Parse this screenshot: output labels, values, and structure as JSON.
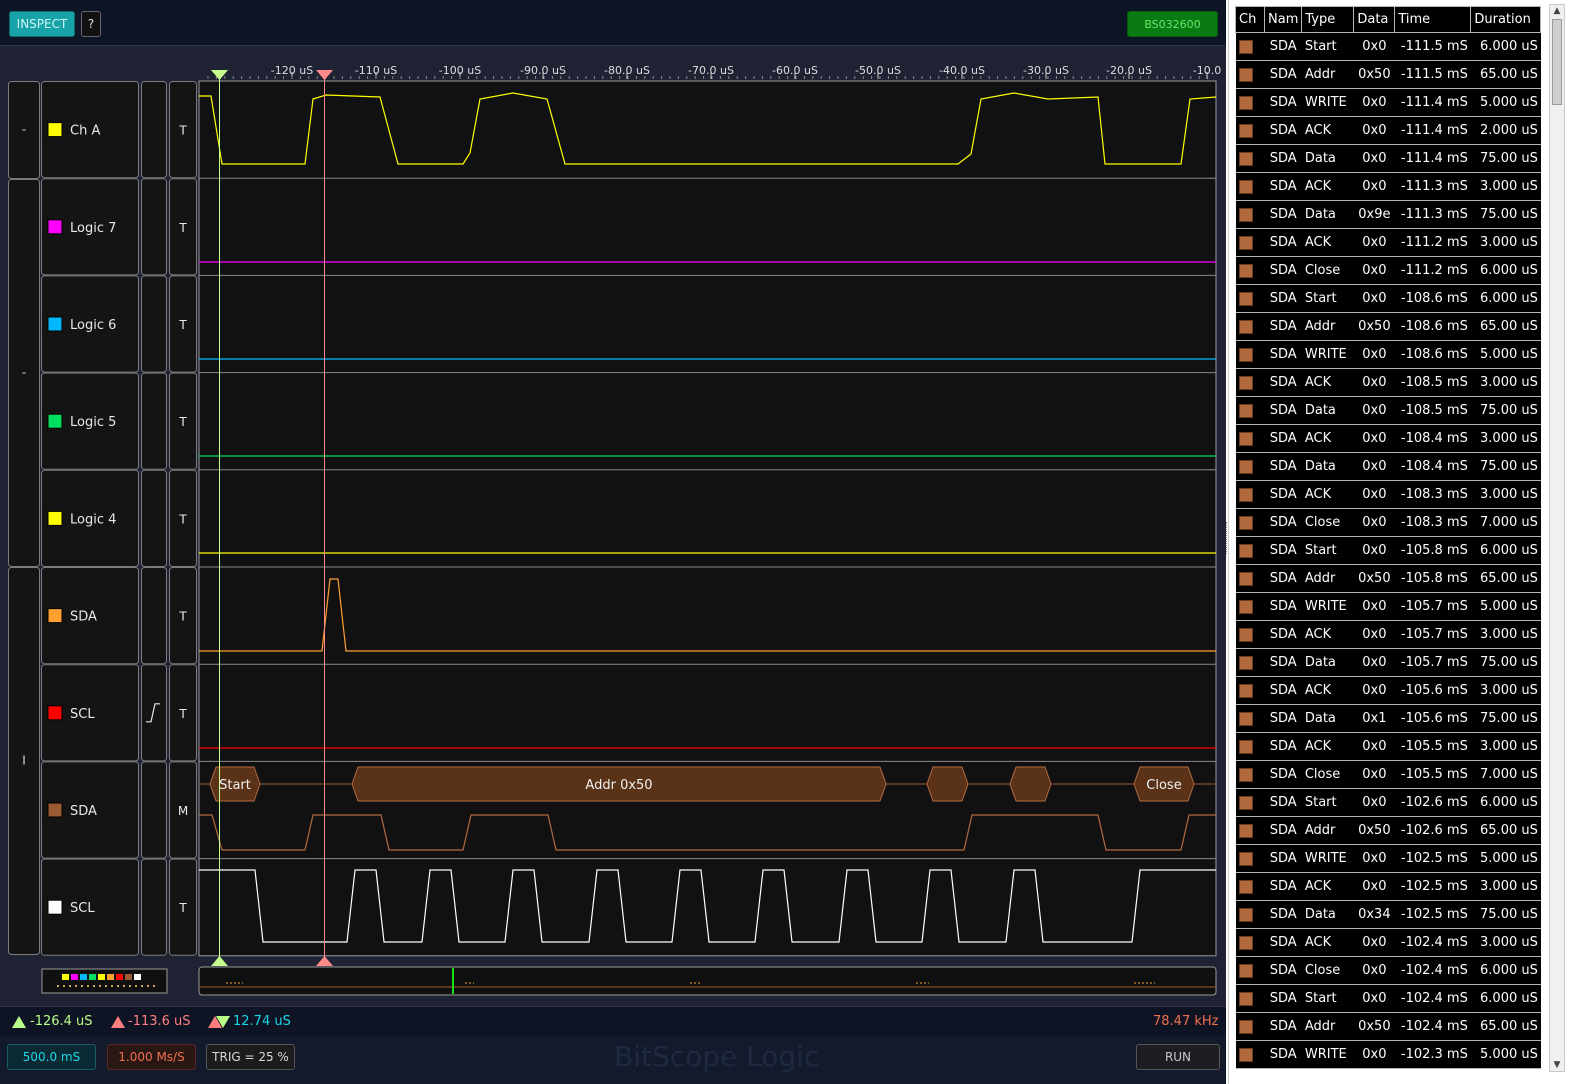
{
  "toolbar": {
    "inspect_label": "INSPECT",
    "help_label": "?",
    "device_label": "BS032600"
  },
  "timeline": {
    "tick_labels": [
      "-120 uS",
      "-110 uS",
      "-100 uS",
      "-90.0 uS",
      "-80.0 uS",
      "-70.0 uS",
      "-60.0 uS",
      "-50.0 uS",
      "-40.0 uS",
      "-30.0 uS",
      "-20.0 uS",
      "-10.0"
    ]
  },
  "groups": [
    "-",
    "-",
    "I"
  ],
  "channels": [
    {
      "name": "Ch A",
      "color": "#ffff00",
      "mode": "T",
      "trigger": ""
    },
    {
      "name": "Logic 7",
      "color": "#ff00ff",
      "mode": "T",
      "trigger": ""
    },
    {
      "name": "Logic 6",
      "color": "#00b8ff",
      "mode": "T",
      "trigger": ""
    },
    {
      "name": "Logic 5",
      "color": "#00e060",
      "mode": "T",
      "trigger": ""
    },
    {
      "name": "Logic 4",
      "color": "#ffff00",
      "mode": "T",
      "trigger": ""
    },
    {
      "name": "SDA",
      "color": "#ffa030",
      "mode": "T",
      "trigger": ""
    },
    {
      "name": "SCL",
      "color": "#ff0000",
      "mode": "T",
      "trigger": "rising-edge"
    },
    {
      "name": "SDA",
      "color": "#9c5a34",
      "mode": "M",
      "trigger": ""
    },
    {
      "name": "SCL",
      "color": "#ffffff",
      "mode": "T",
      "trigger": ""
    }
  ],
  "decode_labels": {
    "start": "Start",
    "addr": "Addr 0x50",
    "close": "Close"
  },
  "cursors": {
    "a_value": "-126.4 uS",
    "b_value": "-113.6 uS",
    "delta_value": "12.74 uS",
    "frequency": "78.47 kHz"
  },
  "bottombar": {
    "timebase": "500.0 mS",
    "sample_rate": "1.000 Ms/S",
    "trigger": "TRIG = 25 %",
    "run_label": "RUN",
    "watermark": "BitScope Logic"
  },
  "table": {
    "headers": [
      "Ch",
      "Nam",
      "Type",
      "Data",
      "Time",
      "Duration"
    ],
    "rows": [
      [
        "SDA",
        "Start",
        "0x0",
        "-111.5 mS",
        "6.000 uS"
      ],
      [
        "SDA",
        "Addr",
        "0x50",
        "-111.5 mS",
        "65.00 uS"
      ],
      [
        "SDA",
        "WRITE",
        "0x0",
        "-111.4 mS",
        "5.000 uS"
      ],
      [
        "SDA",
        "ACK",
        "0x0",
        "-111.4 mS",
        "2.000 uS"
      ],
      [
        "SDA",
        "Data",
        "0x0",
        "-111.4 mS",
        "75.00 uS"
      ],
      [
        "SDA",
        "ACK",
        "0x0",
        "-111.3 mS",
        "3.000 uS"
      ],
      [
        "SDA",
        "Data",
        "0x9e",
        "-111.3 mS",
        "75.00 uS"
      ],
      [
        "SDA",
        "ACK",
        "0x0",
        "-111.2 mS",
        "3.000 uS"
      ],
      [
        "SDA",
        "Close",
        "0x0",
        "-111.2 mS",
        "6.000 uS"
      ],
      [
        "SDA",
        "Start",
        "0x0",
        "-108.6 mS",
        "6.000 uS"
      ],
      [
        "SDA",
        "Addr",
        "0x50",
        "-108.6 mS",
        "65.00 uS"
      ],
      [
        "SDA",
        "WRITE",
        "0x0",
        "-108.6 mS",
        "5.000 uS"
      ],
      [
        "SDA",
        "ACK",
        "0x0",
        "-108.5 mS",
        "3.000 uS"
      ],
      [
        "SDA",
        "Data",
        "0x0",
        "-108.5 mS",
        "75.00 uS"
      ],
      [
        "SDA",
        "ACK",
        "0x0",
        "-108.4 mS",
        "3.000 uS"
      ],
      [
        "SDA",
        "Data",
        "0x0",
        "-108.4 mS",
        "75.00 uS"
      ],
      [
        "SDA",
        "ACK",
        "0x0",
        "-108.3 mS",
        "3.000 uS"
      ],
      [
        "SDA",
        "Close",
        "0x0",
        "-108.3 mS",
        "7.000 uS"
      ],
      [
        "SDA",
        "Start",
        "0x0",
        "-105.8 mS",
        "6.000 uS"
      ],
      [
        "SDA",
        "Addr",
        "0x50",
        "-105.8 mS",
        "65.00 uS"
      ],
      [
        "SDA",
        "WRITE",
        "0x0",
        "-105.7 mS",
        "5.000 uS"
      ],
      [
        "SDA",
        "ACK",
        "0x0",
        "-105.7 mS",
        "3.000 uS"
      ],
      [
        "SDA",
        "Data",
        "0x0",
        "-105.7 mS",
        "75.00 uS"
      ],
      [
        "SDA",
        "ACK",
        "0x0",
        "-105.6 mS",
        "3.000 uS"
      ],
      [
        "SDA",
        "Data",
        "0x1",
        "-105.6 mS",
        "75.00 uS"
      ],
      [
        "SDA",
        "ACK",
        "0x0",
        "-105.5 mS",
        "3.000 uS"
      ],
      [
        "SDA",
        "Close",
        "0x0",
        "-105.5 mS",
        "7.000 uS"
      ],
      [
        "SDA",
        "Start",
        "0x0",
        "-102.6 mS",
        "6.000 uS"
      ],
      [
        "SDA",
        "Addr",
        "0x50",
        "-102.6 mS",
        "65.00 uS"
      ],
      [
        "SDA",
        "WRITE",
        "0x0",
        "-102.5 mS",
        "5.000 uS"
      ],
      [
        "SDA",
        "ACK",
        "0x0",
        "-102.5 mS",
        "3.000 uS"
      ],
      [
        "SDA",
        "Data",
        "0x34",
        "-102.5 mS",
        "75.00 uS"
      ],
      [
        "SDA",
        "ACK",
        "0x0",
        "-102.4 mS",
        "3.000 uS"
      ],
      [
        "SDA",
        "Close",
        "0x0",
        "-102.4 mS",
        "6.000 uS"
      ],
      [
        "SDA",
        "Start",
        "0x0",
        "-102.4 mS",
        "6.000 uS"
      ],
      [
        "SDA",
        "Addr",
        "0x50",
        "-102.4 mS",
        "65.00 uS"
      ],
      [
        "SDA",
        "WRITE",
        "0x0",
        "-102.3 mS",
        "5.000 uS"
      ]
    ]
  }
}
